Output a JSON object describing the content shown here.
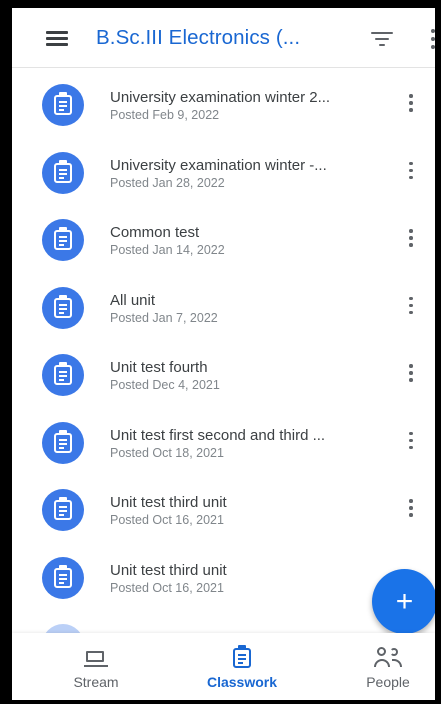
{
  "appbar": {
    "title": "B.Sc.III Electronics (...",
    "title_color": "#1967d2"
  },
  "assignments": [
    {
      "title": "University examination winter 2...",
      "posted": "Posted Feb 9, 2022",
      "icon": "assignment-icon"
    },
    {
      "title": "University examination winter -...",
      "posted": "Posted Jan 28, 2022",
      "icon": "assignment-icon"
    },
    {
      "title": "Common test",
      "posted": "Posted Jan 14, 2022",
      "icon": "assignment-icon"
    },
    {
      "title": "All unit",
      "posted": "Posted Jan 7, 2022",
      "icon": "assignment-icon"
    },
    {
      "title": "Unit test fourth",
      "posted": "Posted Dec 4, 2021",
      "icon": "assignment-icon"
    },
    {
      "title": "Unit test first second and third ...",
      "posted": "Posted Oct 18, 2021",
      "icon": "assignment-icon"
    },
    {
      "title": "Unit test third unit",
      "posted": "Posted Oct 16, 2021",
      "icon": "assignment-icon"
    },
    {
      "title": "Unit test third unit",
      "posted": "Posted Oct 16, 2021",
      "icon": "assignment-icon"
    }
  ],
  "fab": {
    "label": "+",
    "color": "#1a73e8"
  },
  "bottom_nav": {
    "stream": "Stream",
    "classwork": "Classwork",
    "people": "People",
    "active": "classwork"
  },
  "colors": {
    "avatar": "#3b78e7",
    "accent": "#1967d2"
  }
}
